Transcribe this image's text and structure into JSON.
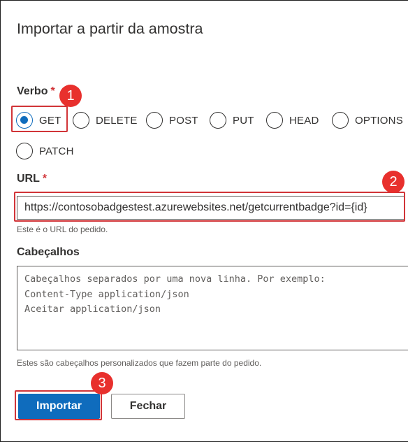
{
  "dialog": {
    "title": "Importar a partir da amostra"
  },
  "verb": {
    "label": "Verbo",
    "required_mark": "*",
    "options": [
      {
        "label": "GET",
        "selected": true
      },
      {
        "label": "DELETE",
        "selected": false
      },
      {
        "label": "POST",
        "selected": false
      },
      {
        "label": "PUT",
        "selected": false
      },
      {
        "label": "HEAD",
        "selected": false
      },
      {
        "label": "OPTIONS",
        "selected": false
      },
      {
        "label": "PATCH",
        "selected": false
      }
    ]
  },
  "url": {
    "label": "URL",
    "required_mark": "*",
    "value": "https://contosobadgestest.azurewebsites.net/getcurrentbadge?id={id}",
    "helper": "Este é o URL do pedido."
  },
  "headers": {
    "label": "Cabeçalhos",
    "placeholder": "Cabeçalhos separados por uma nova linha. Por exemplo:\nContent-Type application/json\nAceitar application/json",
    "helper": "Estes são cabeçalhos personalizados que fazem parte do pedido."
  },
  "actions": {
    "import_label": "Importar",
    "close_label": "Fechar"
  },
  "annotations": {
    "step1": "1",
    "step2": "2",
    "step3": "3"
  },
  "colors": {
    "accent": "#0f6cbd",
    "highlight": "#d13438",
    "badge": "#e8302d"
  }
}
